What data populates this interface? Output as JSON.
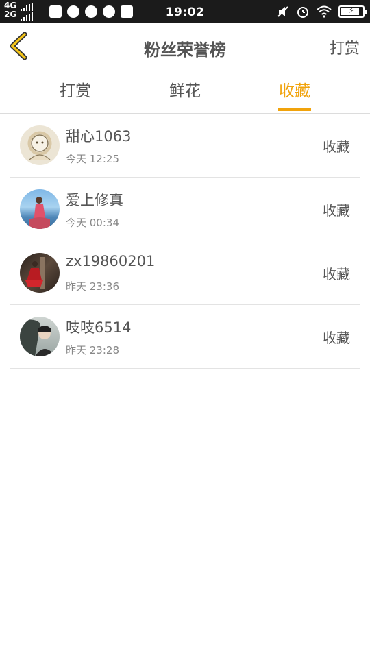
{
  "status_bar": {
    "net_top": "4G",
    "net_bottom": "2G",
    "time": "19:02",
    "icons": [
      "shopping-bag-icon",
      "browser-icon",
      "chat-icon",
      "alarm-icon",
      "database-icon"
    ],
    "right_icons": [
      "mute-icon",
      "alarm-icon",
      "wifi-icon",
      "battery-icon"
    ],
    "battery_level": 0.85
  },
  "header": {
    "title": "粉丝荣誉榜",
    "action": "打赏",
    "accent": "#f1a30c"
  },
  "tabs": [
    {
      "label": "打赏",
      "active": false
    },
    {
      "label": "鲜花",
      "active": false
    },
    {
      "label": "收藏",
      "active": true
    }
  ],
  "list": [
    {
      "name": "甜心1063",
      "time": "今天 12:25",
      "action": "收藏"
    },
    {
      "name": "爱上修真",
      "time": "今天 00:34",
      "action": "收藏"
    },
    {
      "name": "zx19860201",
      "time": "昨天 23:36",
      "action": "收藏"
    },
    {
      "name": "吱吱6514",
      "time": "昨天 23:28",
      "action": "收藏"
    }
  ]
}
